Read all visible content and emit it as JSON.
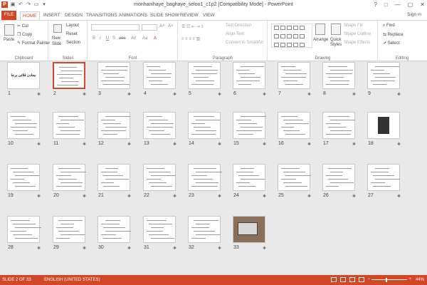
{
  "app": {
    "title": "monhanihaye_baghaye_seloo1_c1p2 [Compatibility Mode] - PowerPoint",
    "brand_color": "#d24726"
  },
  "window_controls": [
    "?",
    "□",
    "—",
    "▢",
    "✕"
  ],
  "tabs": [
    "FILE",
    "HOME",
    "INSERT",
    "DESIGN",
    "TRANSITIONS",
    "ANIMATIONS",
    "SLIDE SHOW",
    "REVIEW",
    "VIEW"
  ],
  "sign_in": "Sign in",
  "ribbon": {
    "clipboard": {
      "paste": "Paste",
      "cut": "Cut",
      "copy": "Copy",
      "format_painter": "Format Painter",
      "label": "Clipboard"
    },
    "slides": {
      "new_slide": "New",
      "new_slide2": "Slide",
      "layout": "Layout",
      "reset": "Reset",
      "section": "Section",
      "label": "Slides"
    },
    "font": {
      "label": "Font"
    },
    "paragraph": {
      "text_direction": "Text Direction",
      "align_text": "Align Text",
      "convert": "Convert to SmartArt",
      "label": "Paragraph"
    },
    "drawing": {
      "arrange": "Arrange",
      "quick_styles": "Quick",
      "quick_styles2": "Styles",
      "shape_fill": "Shape Fill",
      "shape_outline": "Shape Outline",
      "shape_effects": "Shape Effects",
      "label": "Drawing"
    },
    "editing": {
      "find": "Find",
      "replace": "Replace",
      "select": "Select",
      "label": "Editing"
    }
  },
  "slides": [
    {
      "n": "1",
      "title": "معادن فلاتی برجا"
    },
    {
      "n": "2"
    },
    {
      "n": "3"
    },
    {
      "n": "4"
    },
    {
      "n": "5"
    },
    {
      "n": "6"
    },
    {
      "n": "7"
    },
    {
      "n": "8"
    },
    {
      "n": "9"
    },
    {
      "n": "10"
    },
    {
      "n": "11"
    },
    {
      "n": "12"
    },
    {
      "n": "13"
    },
    {
      "n": "14"
    },
    {
      "n": "15"
    },
    {
      "n": "16"
    },
    {
      "n": "17"
    },
    {
      "n": "18"
    },
    {
      "n": "19"
    },
    {
      "n": "20"
    },
    {
      "n": "21"
    },
    {
      "n": "22"
    },
    {
      "n": "23"
    },
    {
      "n": "24"
    },
    {
      "n": "25"
    },
    {
      "n": "26"
    },
    {
      "n": "27"
    },
    {
      "n": "28"
    },
    {
      "n": "29"
    },
    {
      "n": "30"
    },
    {
      "n": "31"
    },
    {
      "n": "32"
    },
    {
      "n": "33"
    }
  ],
  "status": {
    "slide_info": "SLIDE 2 OF 33",
    "language": "ENGLISH (UNITED STATES)",
    "zoom": "44%",
    "zoom_minus": "−",
    "zoom_plus": "+"
  },
  "zoom_level_fraction": 0.44
}
